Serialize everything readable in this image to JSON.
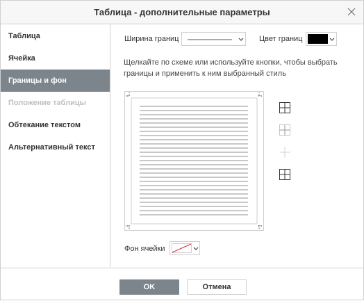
{
  "dialog": {
    "title": "Таблица - дополнительные параметры",
    "close_icon": "close-icon"
  },
  "sidebar": {
    "items": [
      {
        "label": "Таблица",
        "state": "normal"
      },
      {
        "label": "Ячейка",
        "state": "normal"
      },
      {
        "label": "Границы и фон",
        "state": "active"
      },
      {
        "label": "Положение таблицы",
        "state": "disabled"
      },
      {
        "label": "Обтекание текстом",
        "state": "normal"
      },
      {
        "label": "Альтернативный текст",
        "state": "normal"
      }
    ]
  },
  "borders": {
    "width_label": "Ширина границ",
    "color_label": "Цвет границ",
    "color_value": "#000000",
    "hint": "Щелкайте по схеме или используйте кнопки, чтобы выбрать границы и применить к ним выбранный стиль",
    "cell_bg_label": "Фон ячейки",
    "cell_bg_value": "none",
    "preset_icons": [
      "all-borders-icon",
      "inner-borders-icon",
      "no-borders-icon",
      "outer-border-icon"
    ]
  },
  "footer": {
    "ok_label": "OK",
    "cancel_label": "Отмена"
  },
  "colors": {
    "accent": "#7d858c",
    "border": "#cfcfcf"
  }
}
